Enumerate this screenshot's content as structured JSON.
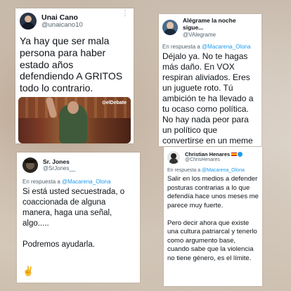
{
  "tweets": [
    {
      "name": "Unai Cano",
      "handle": "@unaicano10",
      "text": "Ya hay que ser mala persona para haber estado años defendiendo A GRITOS todo lo contrario.",
      "media_logo": "⊙elDebate",
      "more_icon": "more-icon"
    },
    {
      "name": "Alégrame la noche sigue...",
      "handle": "@VAlegrame",
      "reply_prefix": "En respuesta a",
      "reply_to": "@Macarena_Olona",
      "text": "Déjalo ya. No te hagas más daño. En VOX respiran aliviados. Eres un juguete roto. Tú ambición te ha llevado a tu ocaso como política. No hay nada peor para un político que convertirse en un meme y tú ya lo has logrado.\nEn Panamá aún puedes"
    },
    {
      "name": "Sr. Jones",
      "handle": "@SrJones__",
      "reply_prefix": "En respuesta a",
      "reply_to": "@Macarena_Olona",
      "text": "Si está usted secuestrada, o coaccionada de alguna manera, haga una señal, algo.....\n\nPodremos ayudarla.",
      "emoji": "✌"
    },
    {
      "name": "Christian Henares",
      "handle": "@ChrisHenares",
      "reply_prefix": "En respuesta a",
      "reply_to": "@Macarena_Olona",
      "text": "Salir en los medios a defender posturas contrarias a lo que defendía hace unos meses me parece muy fuerte.\n\nPero decir ahora que existe una cultura patriarcal y tenerlo como argumento base, cuando sabe que la violencia no tiene género, es el límite."
    }
  ],
  "colors": {
    "link": "#1d9bf0",
    "secondary_text": "#536471",
    "text": "#0f1419"
  }
}
